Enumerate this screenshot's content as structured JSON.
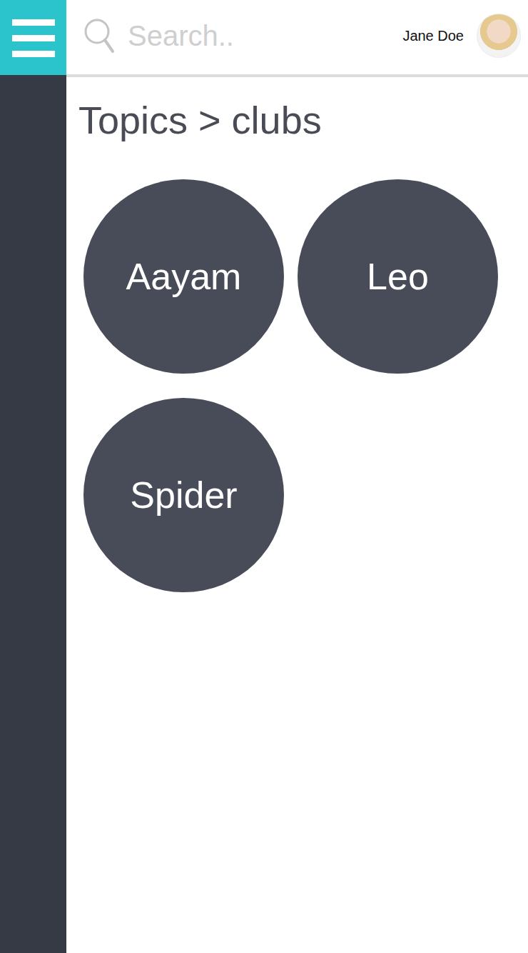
{
  "header": {
    "search": {
      "placeholder": "Search.."
    },
    "user": {
      "name": "Jane Doe"
    }
  },
  "breadcrumb": "Topics > clubs",
  "clubs": [
    {
      "name": "Aayam"
    },
    {
      "name": "Leo"
    },
    {
      "name": "Spider"
    }
  ]
}
